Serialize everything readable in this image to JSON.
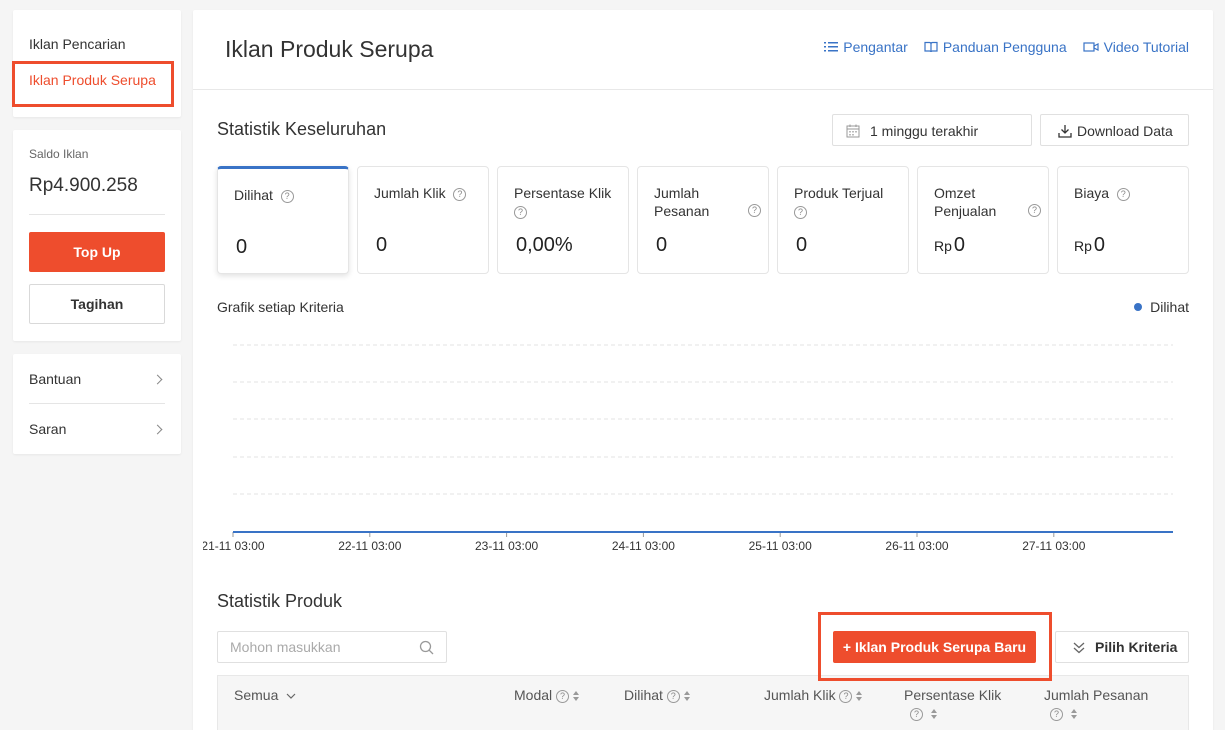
{
  "sidebar": {
    "nav": [
      {
        "label": "Iklan Pencarian"
      },
      {
        "label": "Iklan Produk Serupa"
      }
    ],
    "balance": {
      "label": "Saldo Iklan",
      "value": "Rp4.900.258",
      "topup_label": "Top Up",
      "invoice_label": "Tagihan"
    },
    "help": [
      {
        "label": "Bantuan"
      },
      {
        "label": "Saran"
      }
    ]
  },
  "header": {
    "title": "Iklan Produk Serupa",
    "links": [
      {
        "label": "Pengantar",
        "icon": "list-icon"
      },
      {
        "label": "Panduan Pengguna",
        "icon": "book-icon"
      },
      {
        "label": "Video Tutorial",
        "icon": "video-icon"
      }
    ]
  },
  "overall": {
    "title": "Statistik Keseluruhan",
    "date_range": "1 minggu terakhir",
    "download_label": "Download Data",
    "metrics": [
      {
        "label": "Dilihat",
        "value": "0",
        "currency": ""
      },
      {
        "label": "Jumlah Klik",
        "value": "0",
        "currency": ""
      },
      {
        "label": "Persentase Klik",
        "value": "0,00%",
        "currency": ""
      },
      {
        "label": "Jumlah Pesanan",
        "value": "0",
        "currency": ""
      },
      {
        "label": "Produk Terjual",
        "value": "0",
        "currency": ""
      },
      {
        "label": "Omzet Penjualan",
        "value": "0",
        "currency": "Rp"
      },
      {
        "label": "Biaya",
        "value": "0",
        "currency": "Rp"
      }
    ],
    "chart_title": "Grafik setiap Kriteria"
  },
  "chart_data": {
    "type": "line",
    "x": [
      "21-11 03:00",
      "22-11 03:00",
      "23-11 03:00",
      "24-11 03:00",
      "25-11 03:00",
      "26-11 03:00",
      "27-11 03:00"
    ],
    "series": [
      {
        "name": "Dilihat",
        "values": [
          0,
          0,
          0,
          0,
          0,
          0,
          0
        ],
        "color": "#3973c6"
      }
    ],
    "grid": true,
    "legend": "top-right"
  },
  "products": {
    "title": "Statistik Produk",
    "search_placeholder": "Mohon masukkan",
    "new_button_label": "+ Iklan Produk Serupa Baru",
    "criteria_button_label": "Pilih Kriteria",
    "columns": [
      {
        "label": "Semua"
      },
      {
        "label": "Modal"
      },
      {
        "label": "Dilihat"
      },
      {
        "label": "Jumlah Klik"
      },
      {
        "label": "Persentase Klik"
      },
      {
        "label": "Jumlah Pesanan"
      }
    ]
  },
  "colors": {
    "accent": "#ee4d2d",
    "link": "#3973c6"
  }
}
